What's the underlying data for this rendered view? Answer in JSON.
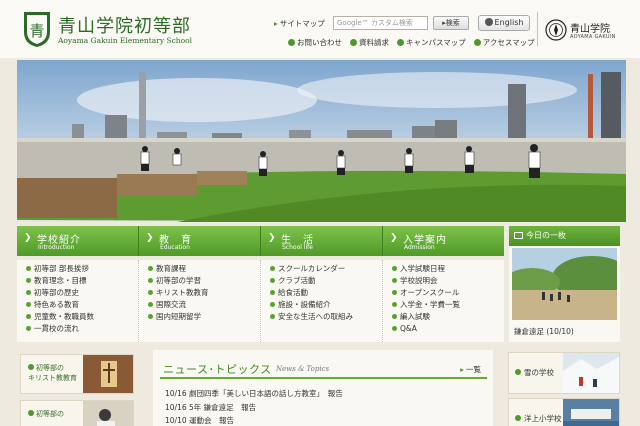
{
  "header": {
    "title": "青山学院初等部",
    "subtitle": "Aoyama Gakuin Elementary School",
    "emblem_glyph": "青",
    "sitemap": "サイトマップ",
    "search_placeholder": "Google™ カスタム検索",
    "search_button": "検索",
    "english_button": "English",
    "gakuin_name": "青山学院",
    "gakuin_en": "AOYAMA GAKUIN",
    "quick_links": [
      "お問い合わせ",
      "資料請求",
      "キャンパスマップ",
      "アクセスマップ"
    ]
  },
  "nav": {
    "tabs": [
      {
        "ja": "学校紹介",
        "en": "Introduction"
      },
      {
        "ja": "教　育",
        "en": "Education"
      },
      {
        "ja": "生　活",
        "en": "School life"
      },
      {
        "ja": "入学案内",
        "en": "Admission"
      }
    ],
    "columns": [
      [
        "初等部 部長挨拶",
        "教育理念・目標",
        "初等部の歴史",
        "特色ある教育",
        "児童数・教職員数",
        "一貫校の流れ"
      ],
      [
        "教育課程",
        "初等部の学習",
        "キリスト教教育",
        "国際交流",
        "国内短期留学"
      ],
      [
        "スクールカレンダー",
        "クラブ活動",
        "給食活動",
        "施設・設備紹介",
        "安全な生活への取組み"
      ],
      [
        "入学試験日程",
        "学校説明会",
        "オープンスクール",
        "入学金・学費一覧",
        "編入試験",
        "Q&A"
      ]
    ]
  },
  "today": {
    "title": "今日の一枚",
    "caption": "鎌倉遠足 (10/10)"
  },
  "left_banners": [
    {
      "lines": [
        "初等部の",
        "キリスト教教育"
      ]
    },
    {
      "lines": [
        "初等部の",
        ""
      ]
    }
  ],
  "news": {
    "title": "ニュース･トピックス",
    "subtitle": "News & Topics",
    "more": "一覧",
    "items": [
      {
        "date": "10/16",
        "text": "劇団四季「美しい日本語の話し方教室」　報告"
      },
      {
        "date": "10/16",
        "text": "5年 鎌倉遠足　報告"
      },
      {
        "date": "10/10",
        "text": "運動会　報告"
      }
    ]
  },
  "right_banners": [
    {
      "label": "雪の学校"
    },
    {
      "label": "洋上小学校"
    }
  ],
  "colors": {
    "brand_green": "#4f9a28",
    "bg": "#efeae0"
  }
}
